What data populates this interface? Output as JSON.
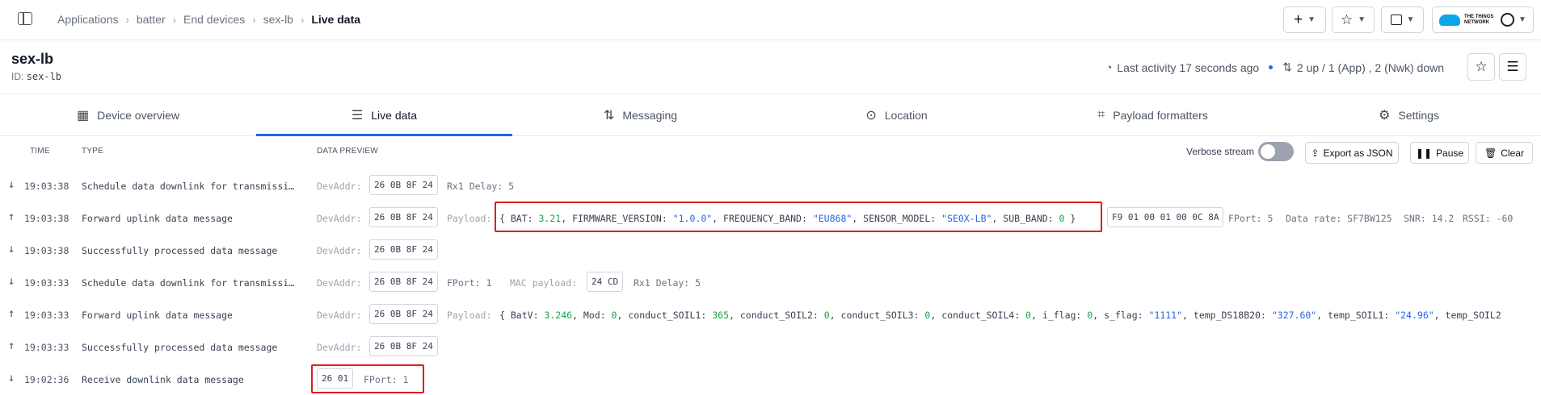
{
  "breadcrumb": [
    "Applications",
    "batter",
    "End devices",
    "sex-lb",
    "Live data"
  ],
  "top_buttons": {
    "ttn_logo_text": "THE THINGS NETWORK"
  },
  "device": {
    "title": "sex-lb",
    "id_label": "ID:",
    "id_value": "sex-lb",
    "last_activity": "Last activity 17 seconds ago",
    "counts": "2 up / 1 (App) , 2 (Nwk) down"
  },
  "tabs": [
    {
      "label": "Device overview",
      "icon": "grid-icon"
    },
    {
      "label": "Live data",
      "icon": "list-icon",
      "active": true
    },
    {
      "label": "Messaging",
      "icon": "arrows-icon"
    },
    {
      "label": "Location",
      "icon": "pin-icon"
    },
    {
      "label": "Payload formatters",
      "icon": "code-icon"
    },
    {
      "label": "Settings",
      "icon": "gear-icon"
    }
  ],
  "table": {
    "headers": {
      "time": "TIME",
      "type": "TYPE",
      "preview": "DATA PREVIEW"
    },
    "verbose_label": "Verbose stream",
    "verbose_on": false,
    "export_label": "Export as JSON",
    "pause_label": "Pause",
    "clear_label": "Clear"
  },
  "rows": [
    {
      "dir": "down",
      "time": "19:03:38",
      "type": "Schedule data downlink for transmissi…",
      "devaddr_label": "DevAddr:",
      "devaddr": "26 0B 8F 24",
      "extra": "Rx1 Delay: 5"
    },
    {
      "dir": "up",
      "time": "19:03:38",
      "type": "Forward uplink data message",
      "devaddr_label": "DevAddr:",
      "devaddr": "26 0B 8F 24",
      "payload_label": "Payload:",
      "payload": {
        "bat_key": "BAT",
        "bat": "3.21",
        "fw_key": "FIRMWARE_VERSION",
        "fw": "\"1.0.0\"",
        "fb_key": "FREQUENCY_BAND",
        "fb": "\"EU868\"",
        "sm_key": "SENSOR_MODEL",
        "sm": "\"SE0X-LB\"",
        "sb_key": "SUB_BAND",
        "sb": "0"
      },
      "raw": "F9 01 00 01 00 0C 8A",
      "fport": "FPort: 5",
      "datarate": "Data rate: SF7BW125",
      "snr": "SNR: 14.2",
      "rssi": "RSSI: -60"
    },
    {
      "dir": "down",
      "time": "19:03:38",
      "type": "Successfully processed data message",
      "devaddr_label": "DevAddr:",
      "devaddr": "26 0B 8F 24"
    },
    {
      "dir": "down",
      "time": "19:03:33",
      "type": "Schedule data downlink for transmissi…",
      "devaddr_label": "DevAddr:",
      "devaddr": "26 0B 8F 24",
      "fport": "FPort: 1",
      "mac_label": "MAC payload:",
      "mac": "24 CD",
      "extra": "Rx1 Delay: 5"
    },
    {
      "dir": "up",
      "time": "19:03:33",
      "type": "Forward uplink data message",
      "devaddr_label": "DevAddr:",
      "devaddr": "26 0B 8F 24",
      "payload_label": "Payload:",
      "payload_text": {
        "p1": "BatV",
        "v1": "3.246",
        "p2": "Mod",
        "v2": "0",
        "p3": "conduct_SOIL1",
        "v3": "365",
        "p4": "conduct_SOIL2",
        "v4": "0",
        "p5": "conduct_SOIL3",
        "v5": "0",
        "p6": "conduct_SOIL4",
        "v6": "0",
        "p7": "i_flag",
        "v7": "0",
        "p8": "s_flag",
        "v8": "\"1111\"",
        "p9": "temp_DS18B20",
        "v9": "\"327.60\"",
        "p10": "temp_SOIL1",
        "v10": "\"24.96\"",
        "p11": "temp_SOIL2"
      }
    },
    {
      "dir": "up",
      "time": "19:03:33",
      "type": "Successfully processed data message",
      "devaddr_label": "DevAddr:",
      "devaddr": "26 0B 8F 24"
    },
    {
      "dir": "down",
      "time": "19:02:36",
      "type": "Receive downlink data message",
      "raw": "26 01",
      "fport": "FPort: 1"
    }
  ],
  "colors": {
    "accent": "#2563eb",
    "highlight": "#e11d1d",
    "number": "#16a34a"
  }
}
